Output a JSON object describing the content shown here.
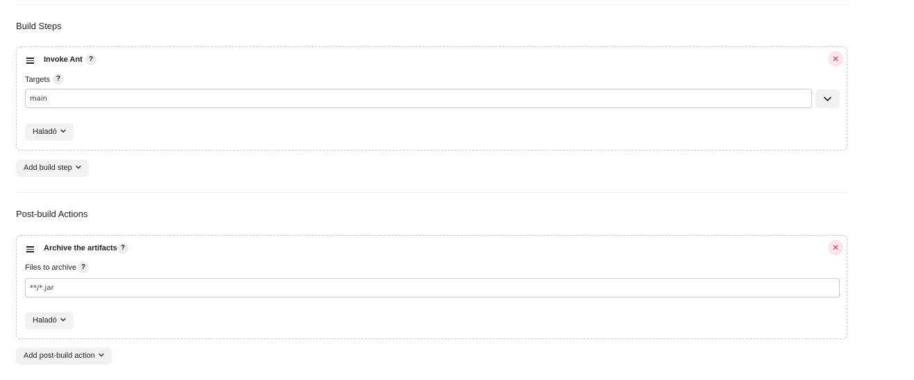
{
  "build_steps": {
    "title": "Build Steps",
    "step": {
      "title": "Invoke Ant",
      "help": "?",
      "remove": "✕",
      "targets_label": "Targets",
      "targets_help": "?",
      "targets_value": "main",
      "advanced_label": "Haladó"
    },
    "add_button": "Add build step"
  },
  "post_build": {
    "title": "Post-build Actions",
    "action": {
      "title": "Archive the artifacts",
      "help": "?",
      "remove": "✕",
      "files_label": "Files to archive",
      "files_help": "?",
      "files_value": "**/*.jar",
      "advanced_label": "Haladó"
    },
    "add_button": "Add post-build action"
  },
  "colors": {
    "remove_bg": "#fce5e8",
    "remove_fg": "#e3334b",
    "button_bg": "#f2f2f3",
    "card_border": "#c8c8cc"
  }
}
